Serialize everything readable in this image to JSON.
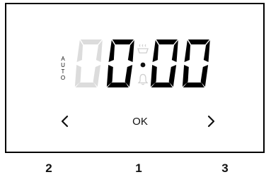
{
  "display": {
    "mode_label": "AUTO",
    "digits": [
      "0",
      "0",
      "0",
      "0"
    ],
    "dimmed_digits": [
      true,
      false,
      false,
      false
    ],
    "separator": "·",
    "icons": {
      "top_status": "oven-tray-icon",
      "bottom_status": "bell-icon"
    },
    "colors": {
      "active": "#000000",
      "dimmed": "#dcdcdc",
      "icon_dimmed": "#cfcfcf"
    }
  },
  "controls": {
    "left_arrow": "<",
    "ok": "OK",
    "right_arrow": ">"
  },
  "keys": {
    "left": "2",
    "center": "1",
    "right": "3"
  }
}
